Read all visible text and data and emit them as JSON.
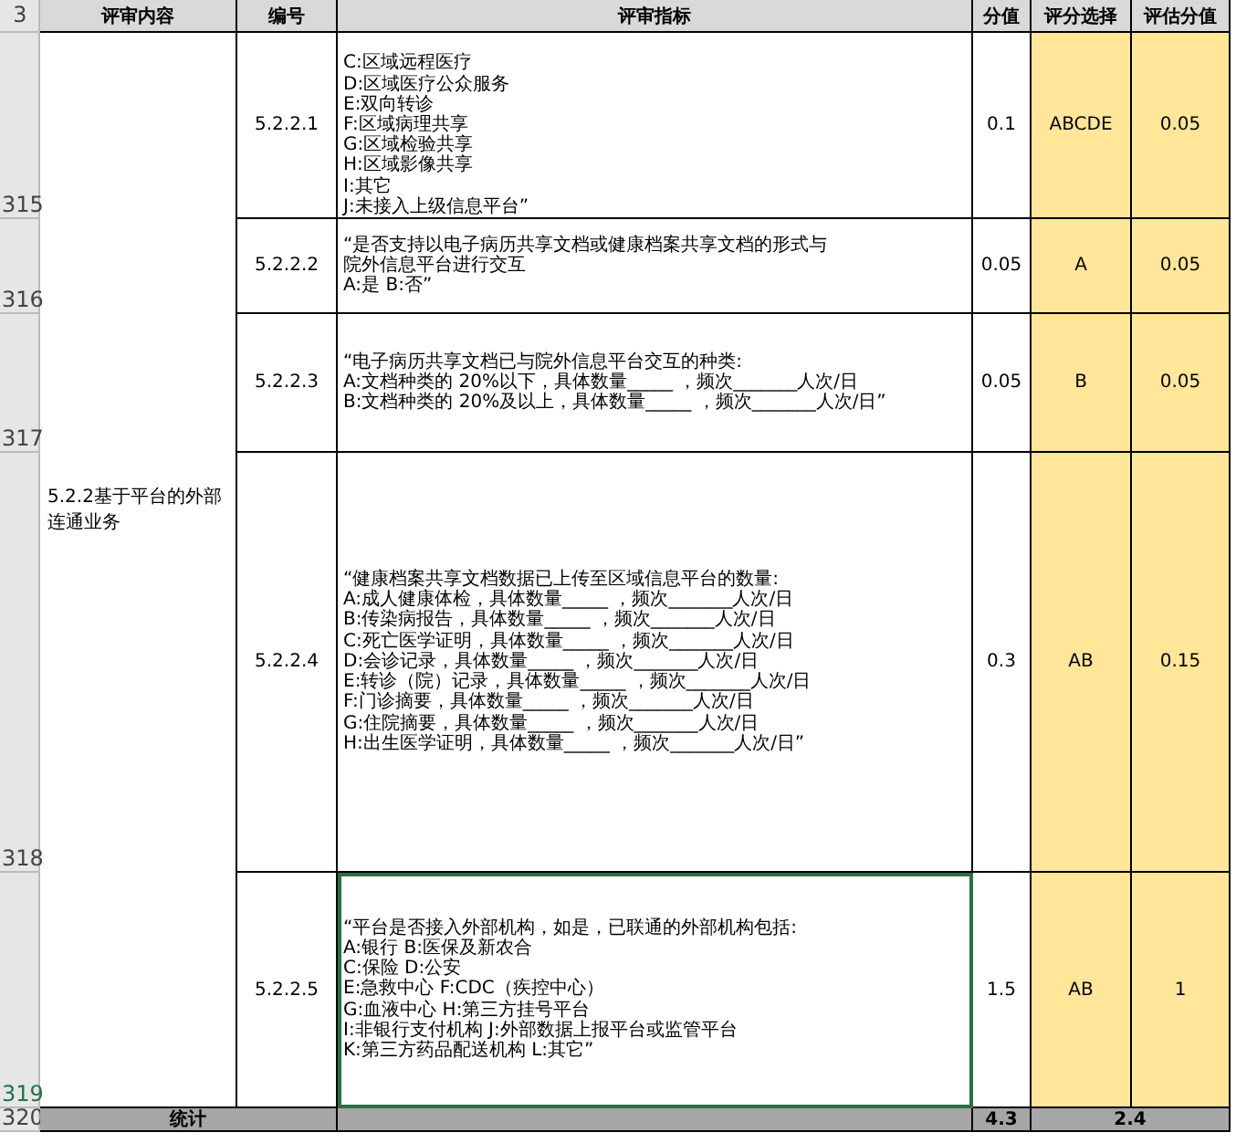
{
  "header": {
    "row_number": "3",
    "columns": [
      "评审内容",
      "编号",
      "评审指标",
      "分值",
      "评分选择",
      "评估分值"
    ]
  },
  "section": {
    "label": "5.2.2基于平台的外部连通业务"
  },
  "rows": [
    {
      "row_number": "315",
      "code": "5.2.2.1",
      "criteria": [
        "C:区域远程医疗",
        "D:区域医疗公众服务",
        "E:双向转诊",
        "F:区域病理共享",
        "G:区域检验共享",
        "H:区域影像共享",
        "I:其它",
        "J:未接入上级信息平台”"
      ],
      "score": "0.1",
      "choice": "ABCDE",
      "assessed": "0.05",
      "selected": false
    },
    {
      "row_number": "316",
      "code": "5.2.2.2",
      "criteria": [
        "“是否支持以电子病历共享文档或健康档案共享文档的形式与",
        "院外信息平台进行交互",
        "A:是 B:否”"
      ],
      "score": "0.05",
      "choice": "A",
      "assessed": "0.05",
      "selected": false
    },
    {
      "row_number": "317",
      "code": "5.2.2.3",
      "criteria": [
        "“电子病历共享文档已与院外信息平台交互的种类:",
        "A:文档种类的 20%以下，具体数量_____ ，频次_______人次/日",
        "B:文档种类的 20%及以上，具体数量_____ ，频次_______人次/日”"
      ],
      "score": "0.05",
      "choice": "B",
      "assessed": "0.05",
      "selected": false
    },
    {
      "row_number": "318",
      "code": "5.2.2.4",
      "criteria": [
        "“健康档案共享文档数据已上传至区域信息平台的数量:",
        "A:成人健康体检，具体数量_____ ，频次_______人次/日",
        "B:传染病报告，具体数量_____ ，频次_______人次/日",
        "C:死亡医学证明，具体数量_____ ，频次_______人次/日",
        "D:会诊记录，具体数量_____ ，频次_______人次/日",
        "E:转诊（院）记录，具体数量_____ ，频次_______人次/日",
        "F:门诊摘要，具体数量_____ ，频次_______人次/日",
        "G:住院摘要，具体数量_____ ，频次_______人次/日",
        "H:出生医学证明，具体数量_____ ，频次_______人次/日”"
      ],
      "score": "0.3",
      "choice": "AB",
      "assessed": "0.15",
      "selected": false
    },
    {
      "row_number": "319",
      "code": "5.2.2.5",
      "criteria": [
        "“平台是否接入外部机构，如是，已联通的外部机构包括:",
        "A:银行 B:医保及新农合",
        "C:保险 D:公安",
        "E:急救中心 F:CDC（疾控中心）",
        "G:血液中心 H:第三方挂号平台",
        "I:非银行支付机构 J:外部数据上报平台或监管平台",
        "K:第三方药品配送机构 L:其它”"
      ],
      "score": "1.5",
      "choice": "AB",
      "assessed": "1",
      "selected": true
    }
  ],
  "total": {
    "row_number": "320",
    "label": "统计",
    "score": "4.3",
    "assessed": "2.4"
  }
}
